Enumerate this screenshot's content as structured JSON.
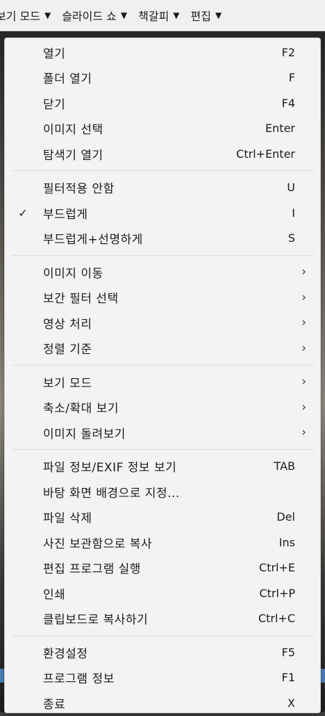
{
  "menubar": {
    "items": [
      {
        "label": "보기 모드"
      },
      {
        "label": "슬라이드 쇼"
      },
      {
        "label": "책갈피"
      },
      {
        "label": "편집"
      }
    ],
    "caret": "▼"
  },
  "menu": {
    "groups": [
      [
        {
          "label": "열기",
          "shortcut": "F2"
        },
        {
          "label": "폴더 열기",
          "shortcut": "F"
        },
        {
          "label": "닫기",
          "shortcut": "F4"
        },
        {
          "label": "이미지 선택",
          "shortcut": "Enter"
        },
        {
          "label": "탐색기 열기",
          "shortcut": "Ctrl+Enter"
        }
      ],
      [
        {
          "label": "필터적용 안함",
          "shortcut": "U"
        },
        {
          "label": "부드럽게",
          "shortcut": "I",
          "checked": true
        },
        {
          "label": "부드럽게+선명하게",
          "shortcut": "S"
        }
      ],
      [
        {
          "label": "이미지 이동",
          "submenu": true
        },
        {
          "label": "보간 필터 선택",
          "submenu": true
        },
        {
          "label": "영상 처리",
          "submenu": true
        },
        {
          "label": "정렬 기준",
          "submenu": true
        }
      ],
      [
        {
          "label": "보기 모드",
          "submenu": true
        },
        {
          "label": "축소/확대 보기",
          "submenu": true
        },
        {
          "label": "이미지 돌려보기",
          "submenu": true
        }
      ],
      [
        {
          "label": "파일 정보/EXIF 정보 보기",
          "shortcut": "TAB"
        },
        {
          "label": "바탕 화면 배경으로 지정...",
          "shortcut": ""
        },
        {
          "label": "파일 삭제",
          "shortcut": "Del"
        },
        {
          "label": "사진 보관함으로 복사",
          "shortcut": "Ins"
        },
        {
          "label": "편집 프로그램 실행",
          "shortcut": "Ctrl+E"
        },
        {
          "label": "인쇄",
          "shortcut": "Ctrl+P"
        },
        {
          "label": "클립보드로 복사하기",
          "shortcut": "Ctrl+C"
        }
      ],
      [
        {
          "label": "환경설정",
          "shortcut": "F5"
        },
        {
          "label": "프로그램 정보",
          "shortcut": "F1"
        },
        {
          "label": "종료",
          "shortcut": "X"
        }
      ]
    ],
    "check_glyph": "✓",
    "submenu_glyph": "›"
  }
}
